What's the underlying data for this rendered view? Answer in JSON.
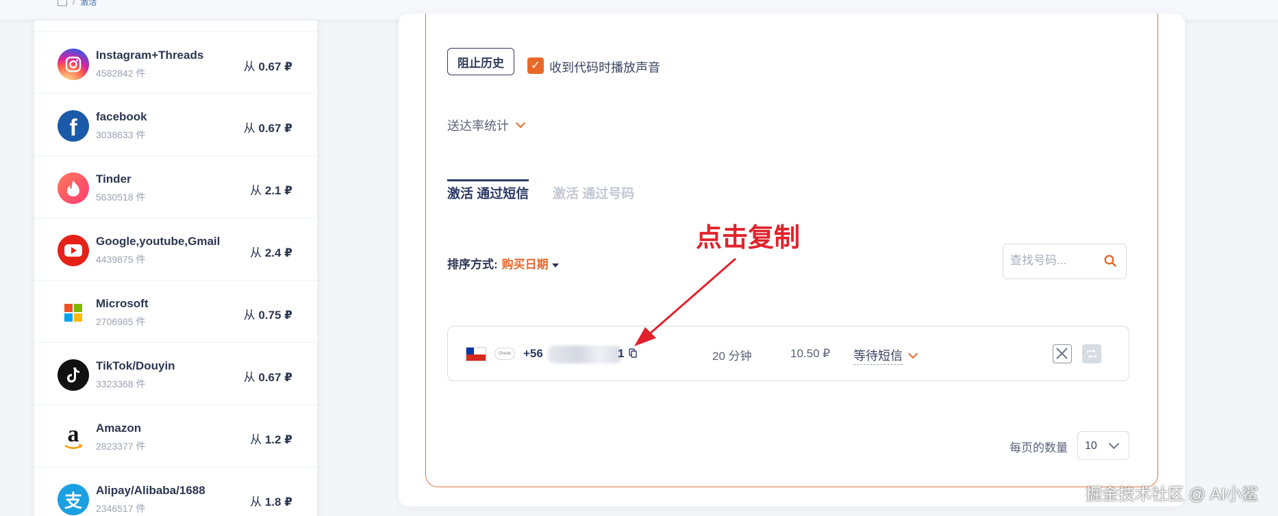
{
  "breadcrumb": {
    "current": "激活"
  },
  "services": [
    {
      "name": "Instagram+Threads",
      "count": "4582842 件",
      "price_prefix": "从",
      "price": "0.67 ₽",
      "icon": "instagram-icon",
      "color": "#e1306c"
    },
    {
      "name": "facebook",
      "count": "3038633 件",
      "price_prefix": "从",
      "price": "0.67 ₽",
      "icon": "facebook-icon",
      "color": "#1877f2"
    },
    {
      "name": "Tinder",
      "count": "5630518 件",
      "price_prefix": "从",
      "price": "2.1 ₽",
      "icon": "tinder-icon",
      "color": "#fd5068"
    },
    {
      "name": "Google,youtube,Gmail",
      "count": "4439875 件",
      "price_prefix": "从",
      "price": "2.4 ₽",
      "icon": "youtube-icon",
      "color": "#e62117"
    },
    {
      "name": "Microsoft",
      "count": "2706985 件",
      "price_prefix": "从",
      "price": "0.75 ₽",
      "icon": "microsoft-icon",
      "color": "#ffffff"
    },
    {
      "name": "TikTok/Douyin",
      "count": "3323368 件",
      "price_prefix": "从",
      "price": "0.67 ₽",
      "icon": "tiktok-icon",
      "color": "#111111"
    },
    {
      "name": "Amazon",
      "count": "2823377 件",
      "price_prefix": "从",
      "price": "1.2 ₽",
      "icon": "amazon-icon",
      "color": "#ffffff"
    },
    {
      "name": "Alipay/Alibaba/1688",
      "count": "2346517 件",
      "price_prefix": "从",
      "price": "1.8 ₽",
      "icon": "alipay-icon",
      "color": "#1ba0e1"
    }
  ],
  "controls": {
    "block_history": "阻止历史",
    "sound_label": "收到代码时播放声音",
    "sound_checked": true,
    "delivery_stats": "送达率统计"
  },
  "tabs": [
    {
      "label": "激活 通过短信",
      "active": true
    },
    {
      "label": "激活 通过号码",
      "active": false
    }
  ],
  "annotation": "点击复制",
  "sort": {
    "label": "排序方式:",
    "value": "购买日期"
  },
  "search": {
    "placeholder": "查找号码..."
  },
  "order": {
    "phone_prefix": "+56",
    "phone_suffix": "1",
    "duration": "20 分钟",
    "price": "10.50 ₽",
    "status": "等待短信",
    "service_logo_text": "Chevik"
  },
  "pagination": {
    "label": "每页的数量",
    "value": "10"
  },
  "watermark": "掘金技术社区 @ AI小鲨",
  "colors": {
    "accent": "#e8682a",
    "navy": "#2c3a66",
    "annotation": "#e1222b"
  }
}
